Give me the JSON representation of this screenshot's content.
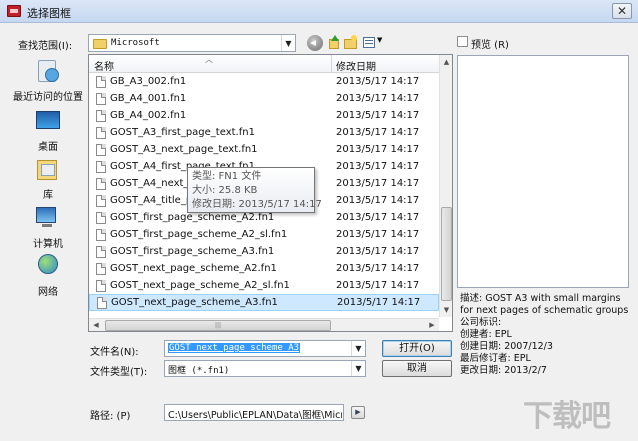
{
  "window": {
    "title": "选择图框",
    "close_glyph": "✕"
  },
  "lookin": {
    "label": "查找范围(I):",
    "value": "Microsoft"
  },
  "places": [
    {
      "label": "最近访问的位置",
      "icon": "recent-places-icon"
    },
    {
      "label": "桌面",
      "icon": "desktop-icon"
    },
    {
      "label": "库",
      "icon": "libraries-icon"
    },
    {
      "label": "计算机",
      "icon": "computer-icon"
    },
    {
      "label": "网络",
      "icon": "network-icon"
    }
  ],
  "columns": {
    "name": "名称",
    "date": "修改日期"
  },
  "files": [
    {
      "name": "GB_A3_002.fn1",
      "date": "2013/5/17 14:17"
    },
    {
      "name": "GB_A4_001.fn1",
      "date": "2013/5/17 14:17"
    },
    {
      "name": "GB_A4_002.fn1",
      "date": "2013/5/17 14:17"
    },
    {
      "name": "GOST_A3_first_page_text.fn1",
      "date": "2013/5/17 14:17"
    },
    {
      "name": "GOST_A3_next_page_text.fn1",
      "date": "2013/5/17 14:17"
    },
    {
      "name": "GOST_A4_first_page_text.fn1",
      "date": "2013/5/17 14:17"
    },
    {
      "name": "GOST_A4_next_pa",
      "date": "2013/5/17 14:17"
    },
    {
      "name": "GOST_A4_title_pa",
      "date": "2013/5/17 14:17"
    },
    {
      "name": "GOST_first_page_scheme_A2.fn1",
      "date": "2013/5/17 14:17"
    },
    {
      "name": "GOST_first_page_scheme_A2_sl.fn1",
      "date": "2013/5/17 14:17"
    },
    {
      "name": "GOST_first_page_scheme_A3.fn1",
      "date": "2013/5/17 14:17"
    },
    {
      "name": "GOST_next_page_scheme_A2.fn1",
      "date": "2013/5/17 14:17"
    },
    {
      "name": "GOST_next_page_scheme_A2_sl.fn1",
      "date": "2013/5/17 14:17"
    },
    {
      "name": "GOST_next_page_scheme_A3.fn1",
      "date": "2013/5/17 14:17"
    }
  ],
  "tooltip": {
    "type": "类型: FN1 文件",
    "size": "大小: 25.8 KB",
    "modified": "修改日期: 2013/5/17 14:17"
  },
  "preview": {
    "label": "预览 (R)",
    "checked": false
  },
  "description": {
    "line1": "描述: GOST A3 with small margins",
    "line2": "for next pages of schematic groups",
    "line3": "公司标识:",
    "creator": "创建者: EPL",
    "created": "创建日期: 2007/12/3",
    "last_modifier": "最后修订者: EPL",
    "changed": "更改日期: 2013/2/7"
  },
  "filename": {
    "label": "文件名(N):",
    "value": "GOST_next_page_scheme_A3"
  },
  "filetype": {
    "label": "文件类型(T):",
    "value": "图框 (*.fn1)"
  },
  "buttons": {
    "open": "打开(O)",
    "cancel": "取消"
  },
  "path": {
    "label": "路径: (P)",
    "value": "C:\\Users\\Public\\EPLAN\\Data\\图框\\Micros"
  },
  "watermark": "下载吧",
  "glyphs": {
    "dropdown": "▼",
    "sort": "︿",
    "up": "▲",
    "down": "▼",
    "left": "◀",
    "right": "▶",
    "hthumb": "|||",
    "go": "▶"
  }
}
